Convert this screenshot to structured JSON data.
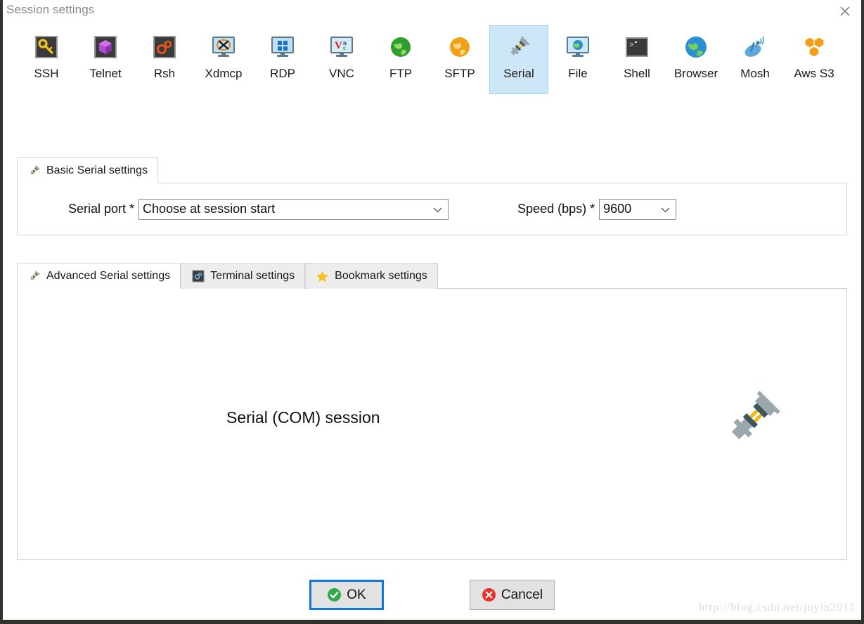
{
  "window": {
    "title": "Session settings",
    "close_icon": "close-icon"
  },
  "protocols": [
    {
      "label": "SSH",
      "icon": "ssh-key-icon"
    },
    {
      "label": "Telnet",
      "icon": "telnet-cube-icon"
    },
    {
      "label": "Rsh",
      "icon": "rsh-gears-icon"
    },
    {
      "label": "Xdmcp",
      "icon": "xdmcp-monitor-icon"
    },
    {
      "label": "RDP",
      "icon": "rdp-windows-monitor-icon"
    },
    {
      "label": "VNC",
      "icon": "vnc-monitor-icon"
    },
    {
      "label": "FTP",
      "icon": "ftp-green-globe-icon"
    },
    {
      "label": "SFTP",
      "icon": "sftp-orange-globe-icon"
    },
    {
      "label": "Serial",
      "icon": "serial-plug-icon",
      "selected": true
    },
    {
      "label": "File",
      "icon": "file-monitor-globe-icon"
    },
    {
      "label": "Shell",
      "icon": "shell-terminal-icon"
    },
    {
      "label": "Browser",
      "icon": "browser-globe-icon"
    },
    {
      "label": "Mosh",
      "icon": "mosh-satellite-icon"
    },
    {
      "label": "Aws S3",
      "icon": "aws-s3-boxes-icon"
    }
  ],
  "basic_tab": {
    "label": "Basic Serial settings",
    "icon": "serial-plug-icon",
    "serial_port": {
      "label": "Serial port *",
      "value": "Choose at session start",
      "options": [
        "Choose at session start"
      ]
    },
    "speed": {
      "label": "Speed (bps) *",
      "value": "9600",
      "options": [
        "9600"
      ]
    }
  },
  "lower_tabs": [
    {
      "label": "Advanced Serial settings",
      "icon": "serial-plug-icon",
      "active": true
    },
    {
      "label": "Terminal settings",
      "icon": "terminal-gear-icon",
      "active": false
    },
    {
      "label": "Bookmark settings",
      "icon": "star-icon",
      "active": false
    }
  ],
  "lower_panel": {
    "caption": "Serial (COM) session",
    "illustration_icon": "serial-plug-icon"
  },
  "footer": {
    "ok": {
      "label": "OK",
      "icon": "check-circle-icon"
    },
    "cancel": {
      "label": "Cancel",
      "icon": "error-circle-icon"
    }
  },
  "watermark": "http://blog.csdn.net/juyin2015",
  "colors": {
    "selected_tab_bg": "#cde6f8",
    "selected_tab_border": "#a6cfe8",
    "focus_outline": "#0c7ad6",
    "ok_icon": "#35a84c",
    "cancel_icon": "#e8312a",
    "panel_border": "#d4d4d4",
    "title_text": "#8a8a8a"
  }
}
